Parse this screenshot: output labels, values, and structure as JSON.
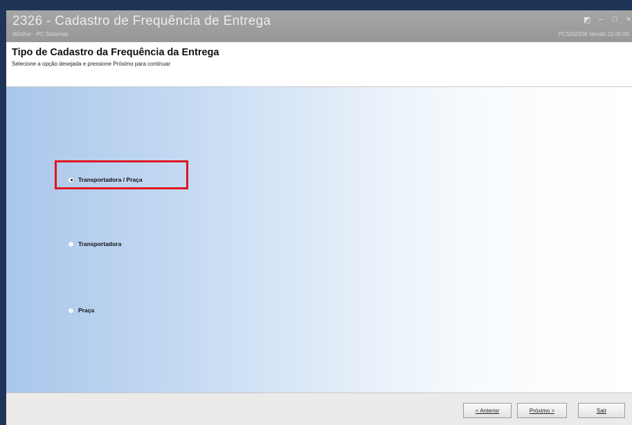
{
  "window": {
    "title": "2326 - Cadastro de Frequência de Entrega",
    "subtitle": "Winthor - PC Sistemas",
    "right_info": "PCSIS2326   Versão 22.00.00",
    "controls": [
      "◩",
      "–",
      "□",
      "×"
    ]
  },
  "header": {
    "title": "Tipo de Cadastro da Frequência da Entrega",
    "subtitle": "Selecione a opção desejada e pressione Próximo para continuar"
  },
  "options": [
    {
      "label": "Transportadora / Praça",
      "selected": true
    },
    {
      "label": "Transportadora",
      "selected": false
    },
    {
      "label": "Praça",
      "selected": false
    }
  ],
  "highlight_color": "#e0131f",
  "footer": {
    "prev_label": "< Anterior",
    "next_label": "Próximo >",
    "exit_label": "Sair"
  }
}
